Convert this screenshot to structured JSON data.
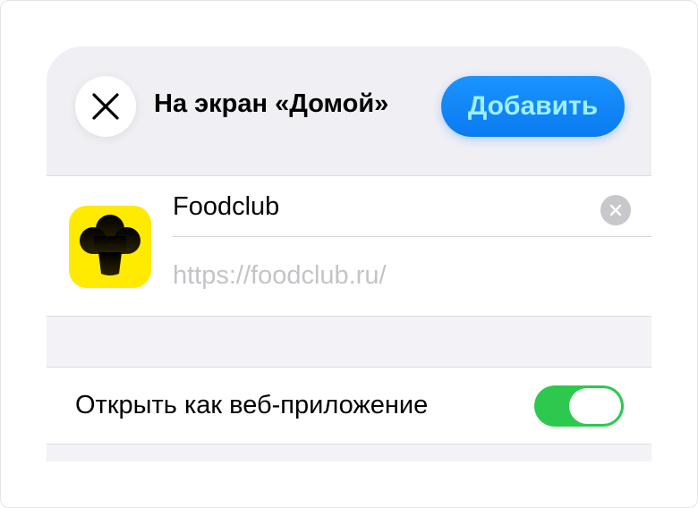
{
  "header": {
    "title": "На экран «Домой»",
    "add_label": "Добавить",
    "close_icon": "close-icon"
  },
  "app": {
    "name": "Foodclub",
    "url": "https://foodclub.ru/",
    "icon": "chef-hat-icon",
    "icon_bg": "#ffea00"
  },
  "web_app_toggle": {
    "label": "Открыть как веб-приложение",
    "on": true,
    "color": "#2dc94f"
  },
  "colors": {
    "accent": "#0a84ff",
    "add_text": "#9ff0ff",
    "sheet_bg": "#f2f2f7"
  }
}
